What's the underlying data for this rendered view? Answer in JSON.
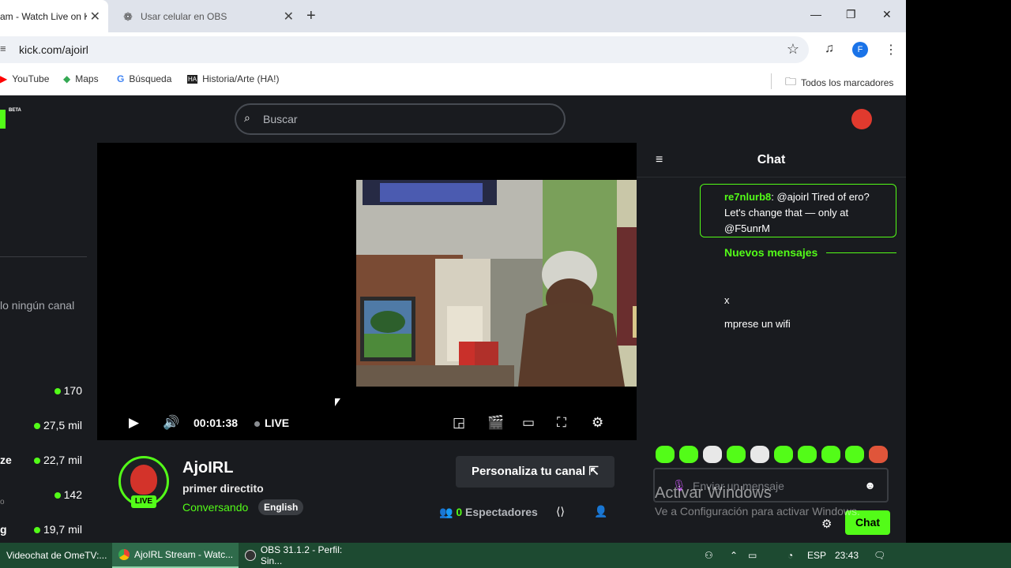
{
  "browser": {
    "tabs": [
      {
        "label": "am - Watch Live on K",
        "active": true
      },
      {
        "label": "Usar celular en OBS",
        "active": false
      }
    ],
    "new_tab_symbol": "+",
    "url": "kick.com/ajoirl",
    "profile_initial": "F",
    "bookmarks": [
      {
        "label": "YouTube",
        "icon": "youtube-icon"
      },
      {
        "label": "Maps",
        "icon": "maps-icon"
      },
      {
        "label": "Búsqueda",
        "icon": "google-icon"
      },
      {
        "label": "Historia/Arte (HA!)",
        "icon": "ha-icon"
      }
    ],
    "all_bookmarks": "Todos los marcadores"
  },
  "kick": {
    "beta_label": "BETA",
    "search_placeholder": "Buscar"
  },
  "sidebar": {
    "empty_text": "lo ningún canal",
    "channels": [
      {
        "name": "",
        "viewers": "170"
      },
      {
        "name": "",
        "viewers": "27,5 mil"
      },
      {
        "name": "ze",
        "viewers": "22,7 mil"
      },
      {
        "name": "o",
        "viewers": "142"
      },
      {
        "name": "g",
        "viewers": "19,7 mil"
      }
    ]
  },
  "player": {
    "time": "00:01:38",
    "live_label": "LIVE"
  },
  "channel": {
    "name": "AjoIRL",
    "live_badge": "LIVE",
    "stream_title": "primer directito",
    "category": "Conversando",
    "language_tag": "English",
    "customize_label": "Personaliza tu canal",
    "viewer_count": "0",
    "viewers_label": "Espectadores"
  },
  "chat": {
    "title": "Chat",
    "pinned_user": "re7nlurb8",
    "pinned_text": ": @ajoirl Tired of ero? Let's change that — only at @F5unrM",
    "new_messages_label": "Nuevos mensajes",
    "messages": [
      "x",
      "mprese un wifi"
    ],
    "input_placeholder": "Enviar un mensaje",
    "send_label": "Chat",
    "emote_count": 10
  },
  "watermark": {
    "line1": "Activar Windows",
    "line2": "Ve a Configuración para activar Windows."
  },
  "taskbar": {
    "items": [
      {
        "label": "Videochat de OmeTV:...",
        "active": false
      },
      {
        "label": "AjoIRL Stream - Watc...",
        "active": true
      },
      {
        "label": "OBS 31.1.2 - Perfil: Sin...",
        "active": false
      }
    ],
    "language": "ESP",
    "clock": "23:43"
  },
  "colors": {
    "kick_green": "#53fc18",
    "page_bg": "#191b1f",
    "taskbar_bg": "#1d4a31"
  }
}
